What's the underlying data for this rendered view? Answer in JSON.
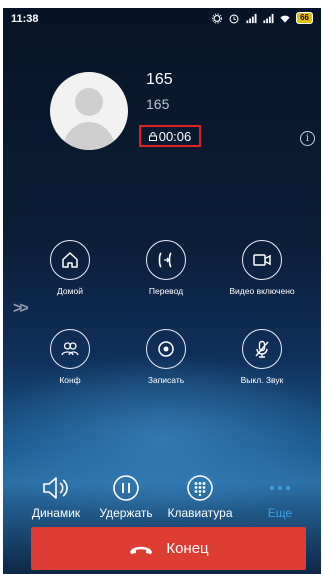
{
  "status_bar": {
    "time": "11:38",
    "battery": "66"
  },
  "call": {
    "caller_name": "165",
    "caller_number": "165",
    "duration": "00:06"
  },
  "actions": [
    {
      "label": "Домой",
      "icon": "home-icon"
    },
    {
      "label": "Перевод",
      "icon": "transfer-icon"
    },
    {
      "label": "Видео включено",
      "icon": "video-camera-icon"
    },
    {
      "label": "Конф",
      "icon": "conference-icon"
    },
    {
      "label": "Записать",
      "icon": "record-icon"
    },
    {
      "label": "Выкл. Звук",
      "icon": "microphone-muted-icon"
    }
  ],
  "bottom_bar": {
    "speaker": "Динамик",
    "hold": "Удержать",
    "keypad": "Клавиатура",
    "more": "Еще"
  },
  "end_call": {
    "label": "Конец"
  },
  "colors": {
    "end_call_bg": "#de3d34",
    "accent": "#3aa0e6",
    "highlight_box": "#e01f1f"
  }
}
